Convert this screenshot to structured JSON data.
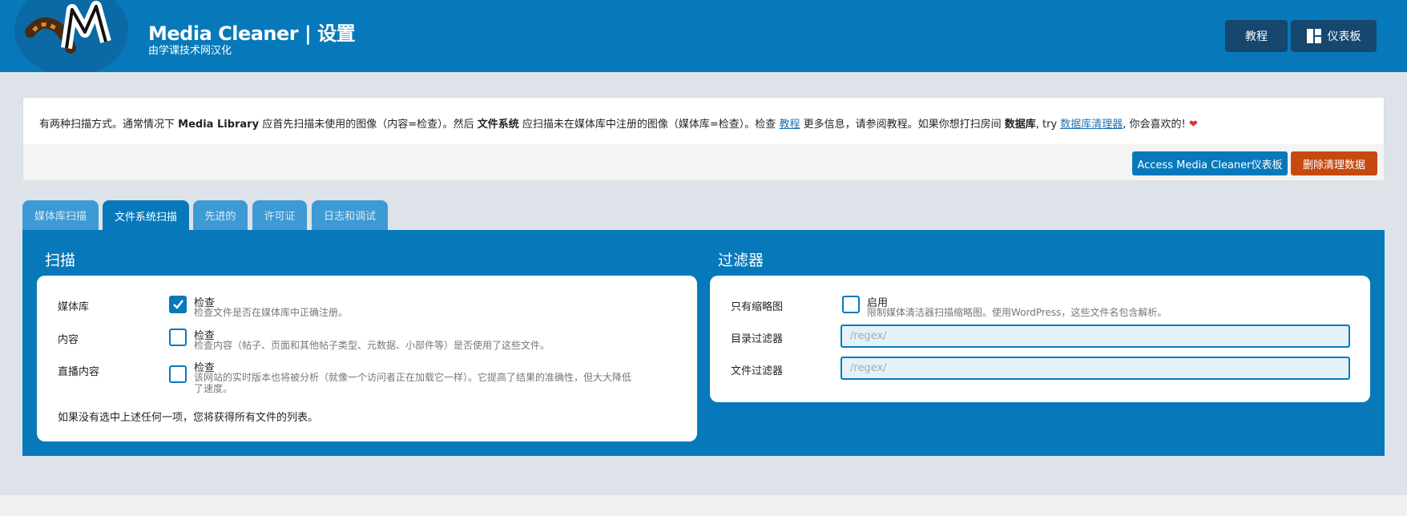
{
  "header": {
    "title": "Media Cleaner | 设置",
    "subtitle": "由学课技术网汉化",
    "tutorial_button": "教程",
    "dashboard_button": "仪表板",
    "logo_icon": "meow-cat-tail-logo"
  },
  "notice": {
    "t1": "有两种扫描方式。通常情况下 ",
    "b1": "Media Library",
    "t2": " 应首先扫描未使用的图像（内容=检查）。然后 ",
    "b2": "文件系统",
    "t3": " 应扫描未在媒体库中注册的图像（媒体库=检查）。检查 ",
    "link1": "教程",
    "t4": " 更多信息，请参阅教程。如果你想打扫房间 ",
    "b3": "数据库",
    "t5": ", try ",
    "link2": "数据库清理器",
    "t6": ", 你会喜欢的! ",
    "heart": "❤",
    "access_button": "Access Media Cleaner仪表板",
    "delete_button": "删除清理数据"
  },
  "tabs": [
    "媒体库扫描",
    "文件系统扫描",
    "先进的",
    "许可证",
    "日志和调试"
  ],
  "active_tab": "文件系统扫描",
  "scan": {
    "title": "扫描",
    "rows": [
      {
        "label": "媒体库",
        "checked": true,
        "option": "检查",
        "desc": "检查文件是否在媒体库中正确注册。"
      },
      {
        "label": "内容",
        "checked": false,
        "option": "检查",
        "desc": "检查内容（帖子、页面和其他帖子类型、元数据、小部件等）是否使用了这些文件。"
      },
      {
        "label": "直播内容",
        "checked": false,
        "option": "检查",
        "desc_line1": "该网站的实时版本也将被分析（就像一个访问者正在加载它一样）。它提高了结果的准确性，但大大降低",
        "desc_line2": "了速度。"
      }
    ],
    "footer": "如果没有选中上述任何一项，您将获得所有文件的列表。"
  },
  "filters": {
    "title": "过滤器",
    "thumbnails_label": "只有缩略图",
    "thumbnails_option": "启用",
    "thumbnails_checked": false,
    "thumbnails_desc": "限制媒体清洁器扫描缩略图。使用WordPress，这些文件名包含解析。",
    "dir_label": "目录过滤器",
    "dir_placeholder": "/regex/",
    "file_label": "文件过滤器",
    "file_placeholder": "/regex/"
  },
  "colors": {
    "primary": "#0779bb",
    "header_button": "#16476e",
    "danger": "#c64a10",
    "page_bg": "#dee3ea"
  }
}
